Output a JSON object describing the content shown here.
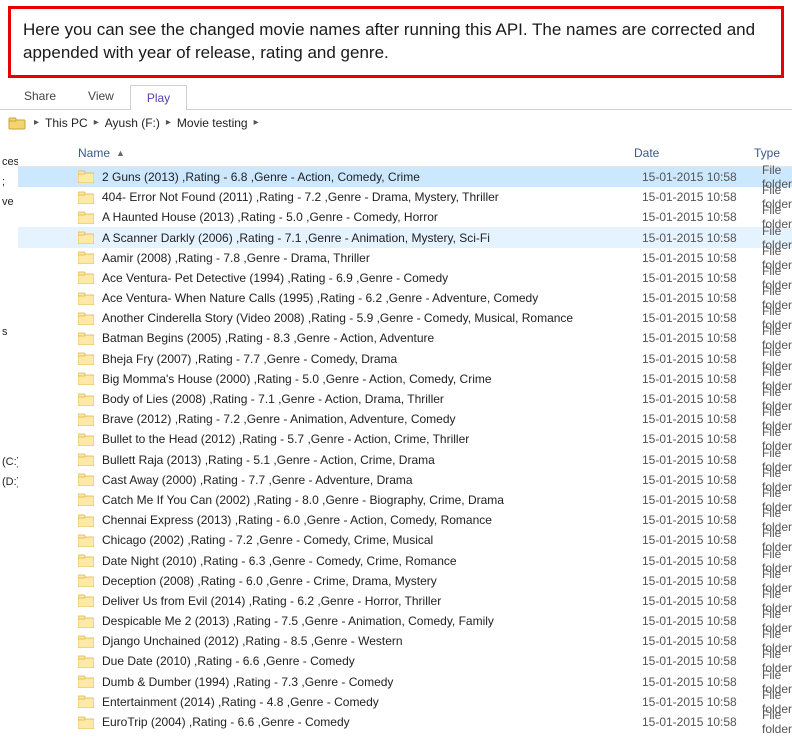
{
  "annotation": "Here you can see the changed movie names after running this API. The names are corrected and appended with year of release, rating and genre.",
  "ribbon": {
    "share": "Share",
    "view": "View",
    "play": "Play"
  },
  "breadcrumb": [
    "This PC",
    "Ayush (F:)",
    "Movie testing"
  ],
  "sidebar": {
    "i0": "ces",
    "i1": ";",
    "i2": "ve",
    "i3": "s",
    "i4": "(C:)",
    "i5": "(D:)"
  },
  "headers": {
    "name": "Name",
    "date": "Date",
    "type": "Type"
  },
  "type_label": "File folder",
  "date_label": "15-01-2015 10:58",
  "rows": [
    {
      "name": "2 Guns (2013) ,Rating - 6.8 ,Genre - Action, Comedy, Crime",
      "sel": true
    },
    {
      "name": "404- Error Not Found (2011) ,Rating - 7.2 ,Genre - Drama, Mystery, Thriller"
    },
    {
      "name": "A Haunted House (2013) ,Rating - 5.0 ,Genre - Comedy, Horror"
    },
    {
      "name": "A Scanner Darkly (2006) ,Rating - 7.1 ,Genre - Animation, Mystery, Sci-Fi",
      "hover": true
    },
    {
      "name": "Aamir (2008) ,Rating - 7.8 ,Genre - Drama, Thriller"
    },
    {
      "name": "Ace Ventura- Pet Detective (1994) ,Rating - 6.9 ,Genre - Comedy"
    },
    {
      "name": "Ace Ventura- When Nature Calls (1995) ,Rating - 6.2 ,Genre - Adventure, Comedy"
    },
    {
      "name": "Another Cinderella Story (Video 2008) ,Rating - 5.9 ,Genre - Comedy, Musical, Romance"
    },
    {
      "name": "Batman Begins (2005) ,Rating - 8.3 ,Genre - Action, Adventure"
    },
    {
      "name": "Bheja Fry (2007) ,Rating - 7.7 ,Genre - Comedy, Drama"
    },
    {
      "name": "Big Momma's House (2000) ,Rating - 5.0 ,Genre - Action, Comedy, Crime"
    },
    {
      "name": "Body of Lies (2008) ,Rating - 7.1 ,Genre - Action, Drama, Thriller"
    },
    {
      "name": "Brave (2012) ,Rating - 7.2 ,Genre - Animation, Adventure, Comedy"
    },
    {
      "name": "Bullet to the Head (2012) ,Rating - 5.7 ,Genre - Action, Crime, Thriller"
    },
    {
      "name": "Bullett Raja (2013) ,Rating - 5.1 ,Genre - Action, Crime, Drama"
    },
    {
      "name": "Cast Away (2000) ,Rating - 7.7 ,Genre - Adventure, Drama"
    },
    {
      "name": "Catch Me If You Can (2002) ,Rating - 8.0 ,Genre - Biography, Crime, Drama"
    },
    {
      "name": "Chennai Express (2013) ,Rating - 6.0 ,Genre - Action, Comedy, Romance"
    },
    {
      "name": "Chicago (2002) ,Rating - 7.2 ,Genre - Comedy, Crime, Musical"
    },
    {
      "name": "Date Night (2010) ,Rating - 6.3 ,Genre - Comedy, Crime, Romance"
    },
    {
      "name": "Deception (2008) ,Rating - 6.0 ,Genre - Crime, Drama, Mystery"
    },
    {
      "name": "Deliver Us from Evil (2014) ,Rating - 6.2 ,Genre - Horror, Thriller"
    },
    {
      "name": "Despicable Me 2 (2013) ,Rating - 7.5 ,Genre - Animation, Comedy, Family"
    },
    {
      "name": "Django Unchained (2012) ,Rating - 8.5 ,Genre - Western"
    },
    {
      "name": "Due Date (2010) ,Rating - 6.6 ,Genre - Comedy"
    },
    {
      "name": "Dumb & Dumber (1994) ,Rating - 7.3 ,Genre - Comedy"
    },
    {
      "name": "Entertainment (2014) ,Rating - 4.8 ,Genre - Comedy"
    },
    {
      "name": "EuroTrip (2004) ,Rating - 6.6 ,Genre - Comedy"
    }
  ]
}
